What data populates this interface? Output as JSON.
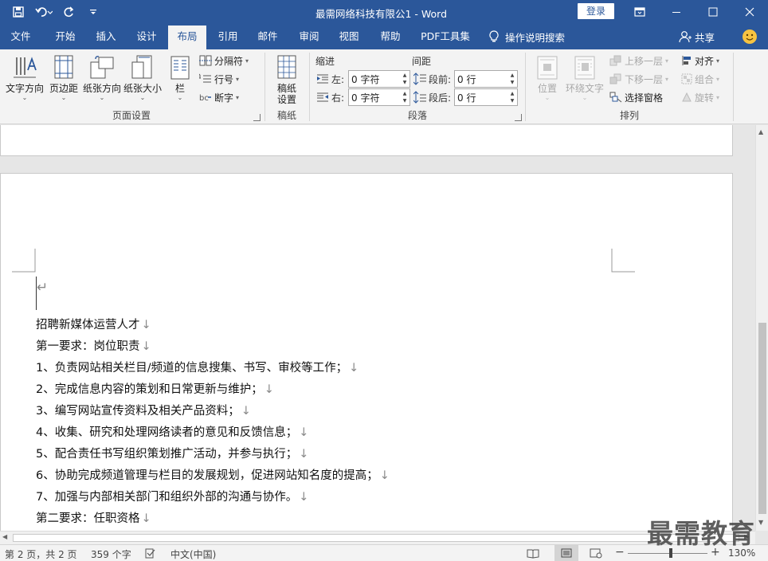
{
  "titlebar": {
    "title": "最需网络科技有限公1  -  Word",
    "login_label": "登录"
  },
  "tabs": [
    {
      "label": "文件"
    },
    {
      "label": "开始"
    },
    {
      "label": "插入"
    },
    {
      "label": "设计"
    },
    {
      "label": "布局",
      "active": true
    },
    {
      "label": "引用"
    },
    {
      "label": "邮件"
    },
    {
      "label": "审阅"
    },
    {
      "label": "视图"
    },
    {
      "label": "帮助"
    },
    {
      "label": "PDF工具集"
    }
  ],
  "tellme": {
    "label": "操作说明搜索"
  },
  "share": {
    "label": "共享"
  },
  "ribbon": {
    "page_setup": {
      "label": "页面设置",
      "text_direction": "文字方向",
      "margins": "页边距",
      "orientation": "纸张方向",
      "size": "纸张大小",
      "columns": "栏",
      "breaks": "分隔符",
      "line_numbers": "行号",
      "hyphenation": "断字"
    },
    "manuscript": {
      "label": "稿纸",
      "button_line1": "稿纸",
      "button_line2": "设置"
    },
    "paragraph": {
      "label": "段落",
      "indent_header": "缩进",
      "spacing_header": "间距",
      "left_label": "左:",
      "right_label": "右:",
      "before_label": "段前:",
      "after_label": "段后:",
      "left_value": "0 字符",
      "right_value": "0 字符",
      "before_value": "0 行",
      "after_value": "0 行"
    },
    "arrange": {
      "label": "排列",
      "position": "位置",
      "wrap_text": "环绕文字",
      "bring_forward": "上移一层",
      "send_backward": "下移一层",
      "selection_pane": "选择窗格",
      "align": "对齐",
      "group": "组合",
      "rotate": "旋转"
    }
  },
  "document": {
    "paragraphs": [
      "招聘新媒体运营人才",
      "第一要求：岗位职责",
      "1、负责网站相关栏目/频道的信息搜集、书写、审校等工作；",
      "2、完成信息内容的策划和日常更新与维护；",
      "3、编写网站宣传资料及相关产品资料；",
      "4、收集、研究和处理网络读者的意见和反馈信息；",
      "5、配合责任书写组织策划推广活动，并参与执行；",
      "6、协助完成频道管理与栏目的发展规划，促进网站知名度的提高；",
      "7、加强与内部相关部门和组织外部的沟通与协作。",
      "第二要求：任职资格"
    ],
    "paragraph_mark": "↓",
    "first_line_mark": "↵"
  },
  "statusbar": {
    "page": "第 2 页，共 2 页",
    "words": "359 个字",
    "language": "中文(中国)",
    "zoom_minus": "−",
    "zoom_plus": "+",
    "zoom": "130%"
  },
  "watermark": "最需教育"
}
